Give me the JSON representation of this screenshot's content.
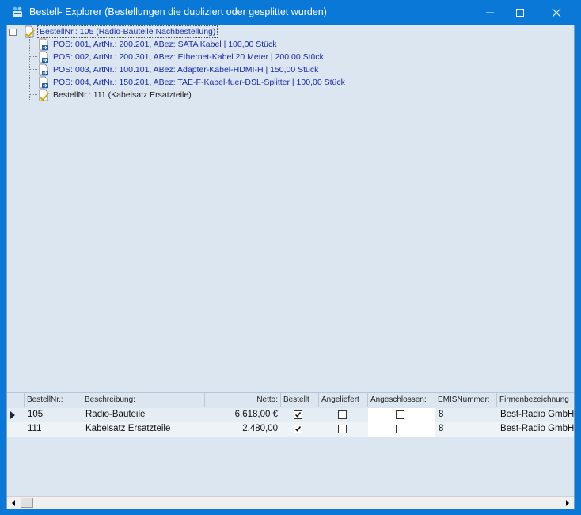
{
  "window": {
    "title": "Bestell- Explorer (Bestellungen die dupliziert oder gesplittet wurden)"
  },
  "tree": {
    "root": {
      "label": "BestellNr.: 105 (Radio-Bauteile Nachbestellung)"
    },
    "positions": [
      {
        "label": "POS: 001, ArtNr.: 200.201, ABez: SATA Kabel | 100,00 Stück"
      },
      {
        "label": "POS: 002, ArtNr.: 200.301, ABez: Ethernet-Kabel 20 Meter | 200,00 Stück"
      },
      {
        "label": "POS: 003, ArtNr.: 100.101, ABez: Adapter-Kabel-HDMI-H | 150,00 Stück"
      },
      {
        "label": "POS: 004, ArtNr.: 150.201, ABez: TAE-F-Kabel-fuer-DSL-Splitter  | 100,00 Stück"
      }
    ],
    "second": {
      "label": "BestellNr.: 111 (Kabelsatz Ersatzteile)"
    }
  },
  "grid": {
    "columns": [
      "BestellNr.:",
      "Beschreibung:",
      "Netto:",
      "Bestellt",
      "Angeliefert",
      "Angeschlossen:",
      "EMISNummer:",
      "Firmenbezeichnung"
    ],
    "rows": [
      {
        "bestellnr": "105",
        "beschreibung": "Radio-Bauteile",
        "netto": "6.618,00 €",
        "bestellt": true,
        "angeliefert": false,
        "angeschlossen": false,
        "emis": "8",
        "firma": "Best-Radio GmbH"
      },
      {
        "bestellnr": "111",
        "beschreibung": "Kabelsatz Ersatzteile",
        "netto": "2.480,00",
        "bestellt": true,
        "angeliefert": false,
        "angeschlossen": false,
        "emis": "8",
        "firma": "Best-Radio GmbH"
      }
    ]
  },
  "colors": {
    "titlebar": "#0a78d6",
    "content_bg": "#dce6f0",
    "tree_link": "#1a2aa8"
  }
}
